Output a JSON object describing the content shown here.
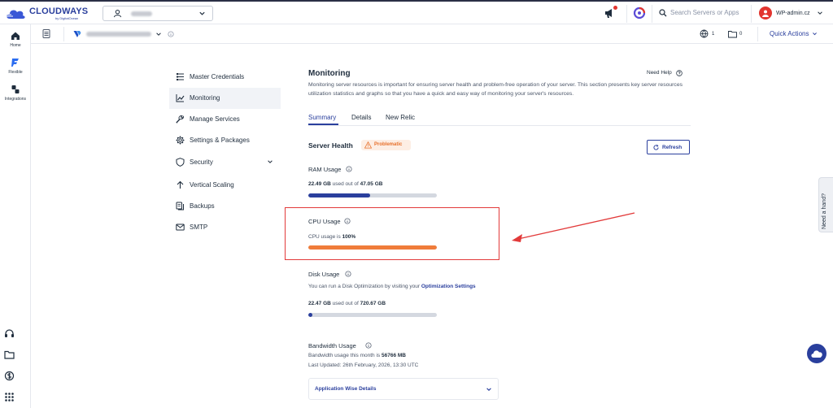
{
  "topbar": {
    "brand": "CLOUDWAYS",
    "brand_sub": "by DigitalOcean",
    "search_placeholder": "Search Servers or Apps",
    "account_name": "WP-admin.cz"
  },
  "subbar": {
    "web_count": "1",
    "folder_count": "0",
    "quick_actions": "Quick Actions"
  },
  "rail": {
    "items": [
      {
        "label": "Home",
        "icon": "home-icon"
      },
      {
        "label": "Flexible",
        "icon": "flexible-icon"
      },
      {
        "label": "Integrations",
        "icon": "integrations-icon"
      }
    ]
  },
  "menu": {
    "items": [
      {
        "label": "Master Credentials",
        "icon": "credentials-icon"
      },
      {
        "label": "Monitoring",
        "icon": "monitoring-icon",
        "active": true
      },
      {
        "label": "Manage Services",
        "icon": "wrench-icon"
      },
      {
        "label": "Settings & Packages",
        "icon": "gear-icon"
      },
      {
        "label": "Security",
        "icon": "shield-icon"
      },
      {
        "label": "Vertical Scaling",
        "icon": "arrow-up-icon"
      },
      {
        "label": "Backups",
        "icon": "backups-icon"
      },
      {
        "label": "SMTP",
        "icon": "mail-icon"
      }
    ]
  },
  "main": {
    "title": "Monitoring",
    "need_help": "Need Help",
    "description": "Monitoring server resources is important for ensuring server health and problem-free operation of your server. This section presents key server resources utilization statistics and graphs so that you have a quick and easy way of monitoring your server's resources.",
    "tabs": [
      "Summary",
      "Details",
      "New Relic"
    ],
    "server_health": {
      "title": "Server Health",
      "status": "Problematic",
      "refresh_label": "Refresh"
    },
    "ram": {
      "label": "RAM Usage",
      "used": "22.49 GB",
      "used_text": "used out of",
      "total": "47.05 GB",
      "fraction": 0.478,
      "color": "#2a3f9d"
    },
    "cpu": {
      "label": "CPU Usage",
      "text": "CPU usage is",
      "value": "100%",
      "fraction": 1.0,
      "color": "#f07c3a"
    },
    "disk": {
      "label": "Disk Usage",
      "text": "You can run a Disk Optimization by visiting your",
      "link": "Optimization Settings",
      "used": "22.47 GB",
      "used_text": "used out of",
      "total": "720.67 GB",
      "fraction": 0.031,
      "color": "#2a3f9d"
    },
    "bandwidth": {
      "label": "Bandwidth Usage",
      "text": "Bandwidth usage this month is",
      "value": "56766 MB",
      "updated": "Last Updated: 26th February, 2026, 13:30 UTC",
      "app_wise": "Application Wise Details"
    }
  },
  "widgets": {
    "need_hand": "Need a hand?"
  },
  "colors": {
    "accent": "#2a3f9d",
    "warning": "#f07c3a",
    "annotation": "#e23a3a"
  }
}
